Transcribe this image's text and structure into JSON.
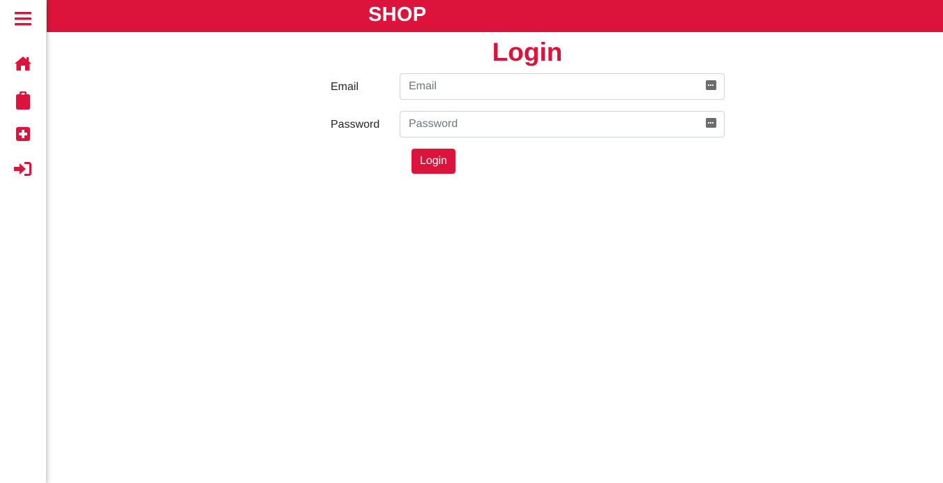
{
  "app": {
    "brand": "SHOP",
    "accent_color": "#dc143c"
  },
  "sidebar": {
    "items": [
      {
        "icon": "hamburger-menu-icon"
      },
      {
        "icon": "home-icon"
      },
      {
        "icon": "clipboard-icon"
      },
      {
        "icon": "plus-square-icon"
      },
      {
        "icon": "sign-in-icon"
      }
    ]
  },
  "login": {
    "title": "Login",
    "email_label": "Email",
    "email_placeholder": "Email",
    "email_value": "",
    "password_label": "Password",
    "password_placeholder": "Password",
    "password_value": "",
    "submit_label": "Login",
    "field_icon": "password-manager-key-icon"
  }
}
